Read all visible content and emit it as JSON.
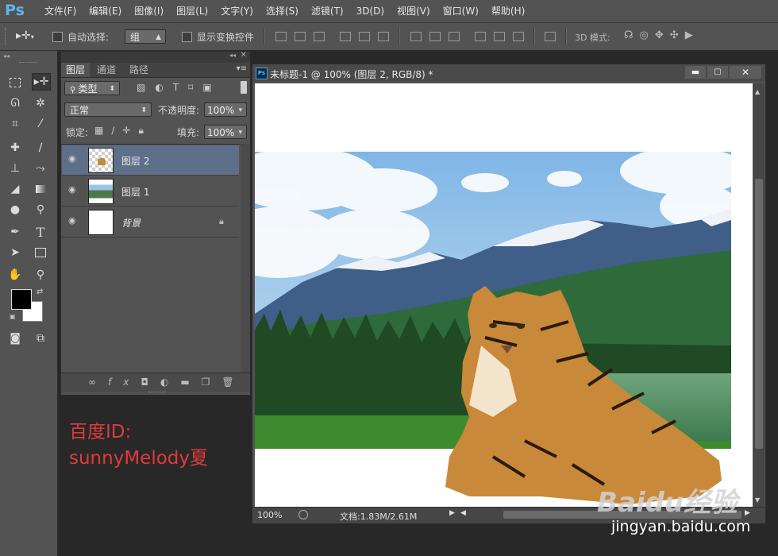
{
  "app": {
    "logo": "Ps"
  },
  "menu": [
    "文件(F)",
    "编辑(E)",
    "图像(I)",
    "图层(L)",
    "文字(Y)",
    "选择(S)",
    "滤镜(T)",
    "3D(D)",
    "视图(V)",
    "窗口(W)",
    "帮助(H)"
  ],
  "options_bar": {
    "auto_select_label": "自动选择:",
    "auto_select_value": "组",
    "show_transform_label": "显示变换控件",
    "mode_3d_label": "3D 模式:"
  },
  "layers_panel": {
    "tabs": [
      "图层",
      "通道",
      "路径"
    ],
    "filter_kind": "类型",
    "blend_mode": "正常",
    "opacity_label": "不透明度:",
    "opacity_value": "100%",
    "lock_label": "锁定:",
    "fill_label": "填充:",
    "fill_value": "100%",
    "layers": [
      {
        "name": "图层 2",
        "selected": true
      },
      {
        "name": "图层 1",
        "selected": false
      },
      {
        "name": "背景",
        "selected": false,
        "locked": true
      }
    ]
  },
  "document": {
    "title": "未标题-1 @ 100% (图层 2, RGB/8) *",
    "zoom": "100%",
    "doc_info": "文档:1.83M/2.61M"
  },
  "watermark": {
    "line1": "百度ID:",
    "line2": "sunnyMelody夏"
  },
  "baidu": {
    "logo_text": "Baidu经验",
    "url": "jingyan.baidu.com"
  },
  "colors": {
    "ui_panel": "#535353",
    "workspace": "#282828",
    "selection": "#5e7089",
    "watermark_red": "#e03a3a",
    "ps_blue": "#5fb6ee"
  }
}
